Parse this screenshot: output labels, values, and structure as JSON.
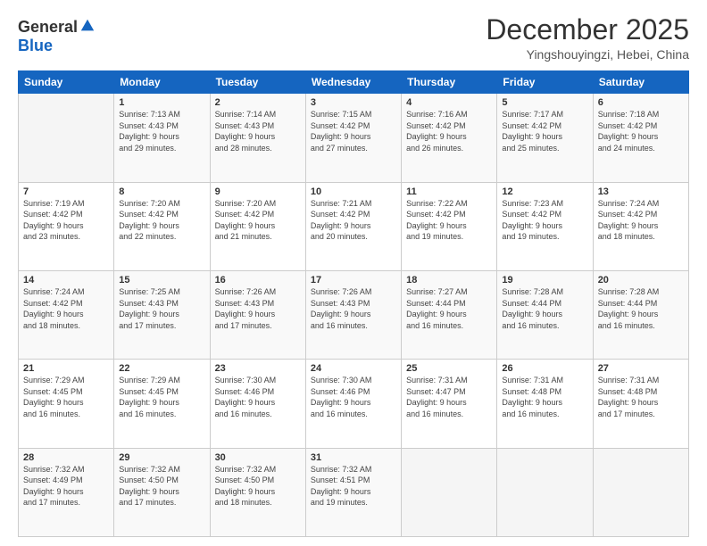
{
  "logo": {
    "general": "General",
    "blue": "Blue"
  },
  "title": "December 2025",
  "location": "Yingshouyingzi, Hebei, China",
  "days_of_week": [
    "Sunday",
    "Monday",
    "Tuesday",
    "Wednesday",
    "Thursday",
    "Friday",
    "Saturday"
  ],
  "weeks": [
    [
      {
        "num": "",
        "info": ""
      },
      {
        "num": "1",
        "info": "Sunrise: 7:13 AM\nSunset: 4:43 PM\nDaylight: 9 hours\nand 29 minutes."
      },
      {
        "num": "2",
        "info": "Sunrise: 7:14 AM\nSunset: 4:43 PM\nDaylight: 9 hours\nand 28 minutes."
      },
      {
        "num": "3",
        "info": "Sunrise: 7:15 AM\nSunset: 4:42 PM\nDaylight: 9 hours\nand 27 minutes."
      },
      {
        "num": "4",
        "info": "Sunrise: 7:16 AM\nSunset: 4:42 PM\nDaylight: 9 hours\nand 26 minutes."
      },
      {
        "num": "5",
        "info": "Sunrise: 7:17 AM\nSunset: 4:42 PM\nDaylight: 9 hours\nand 25 minutes."
      },
      {
        "num": "6",
        "info": "Sunrise: 7:18 AM\nSunset: 4:42 PM\nDaylight: 9 hours\nand 24 minutes."
      }
    ],
    [
      {
        "num": "7",
        "info": "Sunrise: 7:19 AM\nSunset: 4:42 PM\nDaylight: 9 hours\nand 23 minutes."
      },
      {
        "num": "8",
        "info": "Sunrise: 7:20 AM\nSunset: 4:42 PM\nDaylight: 9 hours\nand 22 minutes."
      },
      {
        "num": "9",
        "info": "Sunrise: 7:20 AM\nSunset: 4:42 PM\nDaylight: 9 hours\nand 21 minutes."
      },
      {
        "num": "10",
        "info": "Sunrise: 7:21 AM\nSunset: 4:42 PM\nDaylight: 9 hours\nand 20 minutes."
      },
      {
        "num": "11",
        "info": "Sunrise: 7:22 AM\nSunset: 4:42 PM\nDaylight: 9 hours\nand 19 minutes."
      },
      {
        "num": "12",
        "info": "Sunrise: 7:23 AM\nSunset: 4:42 PM\nDaylight: 9 hours\nand 19 minutes."
      },
      {
        "num": "13",
        "info": "Sunrise: 7:24 AM\nSunset: 4:42 PM\nDaylight: 9 hours\nand 18 minutes."
      }
    ],
    [
      {
        "num": "14",
        "info": "Sunrise: 7:24 AM\nSunset: 4:42 PM\nDaylight: 9 hours\nand 18 minutes."
      },
      {
        "num": "15",
        "info": "Sunrise: 7:25 AM\nSunset: 4:43 PM\nDaylight: 9 hours\nand 17 minutes."
      },
      {
        "num": "16",
        "info": "Sunrise: 7:26 AM\nSunset: 4:43 PM\nDaylight: 9 hours\nand 17 minutes."
      },
      {
        "num": "17",
        "info": "Sunrise: 7:26 AM\nSunset: 4:43 PM\nDaylight: 9 hours\nand 16 minutes."
      },
      {
        "num": "18",
        "info": "Sunrise: 7:27 AM\nSunset: 4:44 PM\nDaylight: 9 hours\nand 16 minutes."
      },
      {
        "num": "19",
        "info": "Sunrise: 7:28 AM\nSunset: 4:44 PM\nDaylight: 9 hours\nand 16 minutes."
      },
      {
        "num": "20",
        "info": "Sunrise: 7:28 AM\nSunset: 4:44 PM\nDaylight: 9 hours\nand 16 minutes."
      }
    ],
    [
      {
        "num": "21",
        "info": "Sunrise: 7:29 AM\nSunset: 4:45 PM\nDaylight: 9 hours\nand 16 minutes."
      },
      {
        "num": "22",
        "info": "Sunrise: 7:29 AM\nSunset: 4:45 PM\nDaylight: 9 hours\nand 16 minutes."
      },
      {
        "num": "23",
        "info": "Sunrise: 7:30 AM\nSunset: 4:46 PM\nDaylight: 9 hours\nand 16 minutes."
      },
      {
        "num": "24",
        "info": "Sunrise: 7:30 AM\nSunset: 4:46 PM\nDaylight: 9 hours\nand 16 minutes."
      },
      {
        "num": "25",
        "info": "Sunrise: 7:31 AM\nSunset: 4:47 PM\nDaylight: 9 hours\nand 16 minutes."
      },
      {
        "num": "26",
        "info": "Sunrise: 7:31 AM\nSunset: 4:48 PM\nDaylight: 9 hours\nand 16 minutes."
      },
      {
        "num": "27",
        "info": "Sunrise: 7:31 AM\nSunset: 4:48 PM\nDaylight: 9 hours\nand 17 minutes."
      }
    ],
    [
      {
        "num": "28",
        "info": "Sunrise: 7:32 AM\nSunset: 4:49 PM\nDaylight: 9 hours\nand 17 minutes."
      },
      {
        "num": "29",
        "info": "Sunrise: 7:32 AM\nSunset: 4:50 PM\nDaylight: 9 hours\nand 17 minutes."
      },
      {
        "num": "30",
        "info": "Sunrise: 7:32 AM\nSunset: 4:50 PM\nDaylight: 9 hours\nand 18 minutes."
      },
      {
        "num": "31",
        "info": "Sunrise: 7:32 AM\nSunset: 4:51 PM\nDaylight: 9 hours\nand 19 minutes."
      },
      {
        "num": "",
        "info": ""
      },
      {
        "num": "",
        "info": ""
      },
      {
        "num": "",
        "info": ""
      }
    ]
  ]
}
